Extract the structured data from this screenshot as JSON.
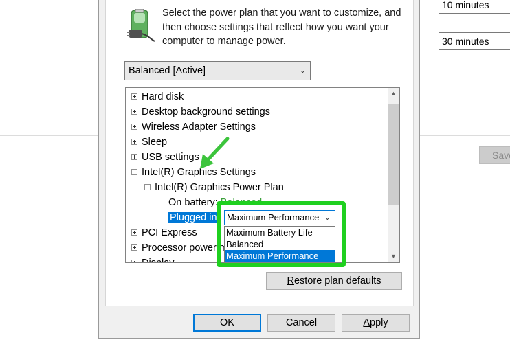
{
  "background": {
    "sleep_after_value": "10 minutes",
    "hibernate_after_value": "30 minutes",
    "save_button_label": "Save"
  },
  "dialog": {
    "intro_text": "Select the power plan that you want to customize, and then choose settings that reflect how you want your computer to manage power.",
    "plan_select_value": "Balanced [Active]",
    "tree": {
      "hard_disk": "Hard disk",
      "desktop_background": "Desktop background settings",
      "wireless_adapter": "Wireless Adapter Settings",
      "sleep": "Sleep",
      "usb": "USB settings",
      "intel_graphics": "Intel(R) Graphics Settings",
      "intel_power_plan": "Intel(R) Graphics Power Plan",
      "on_battery_label": "On battery:",
      "on_battery_value": "Balanced",
      "plugged_in_label": "Plugged in:",
      "pci_express": "PCI Express",
      "processor_power": "Processor power management",
      "display": "Display"
    },
    "dropdown": {
      "selected": "Maximum Performance",
      "options": [
        "Maximum Battery Life",
        "Balanced",
        "Maximum Performance"
      ]
    },
    "buttons": {
      "restore_first": "R",
      "restore_rest": "estore plan defaults",
      "ok": "OK",
      "cancel": "Cancel",
      "apply_first": "A",
      "apply_rest": "pply"
    }
  },
  "colors": {
    "highlight_box": "#1fd01f",
    "selection": "#0078d7",
    "arrow": "#3cc43c"
  }
}
